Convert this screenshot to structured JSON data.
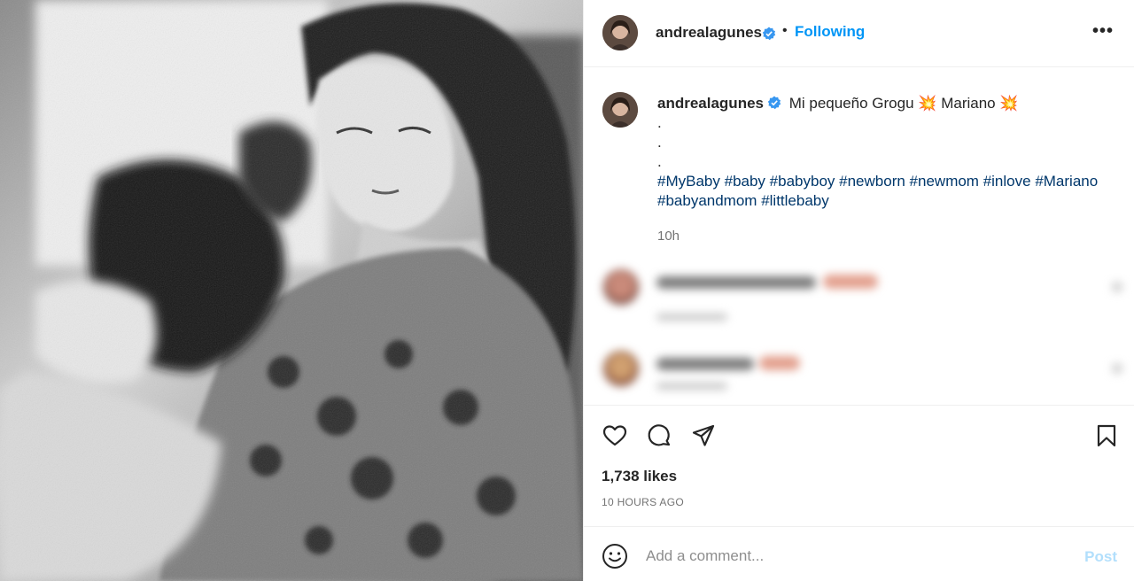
{
  "post": {
    "author": "andrealagunes",
    "follow_separator": "•",
    "follow_label": "Following",
    "more_label": "•••"
  },
  "caption": {
    "author": "andrealagunes",
    "text_before": "Mi pequeño Grogu",
    "emoji_1": "💥",
    "text_middle": "Mariano",
    "emoji_2": "💥",
    "dot_lines": [
      ".",
      ".",
      "."
    ],
    "hashtags": [
      "#MyBaby",
      "#baby",
      "#babyboy",
      "#newborn",
      "#newmom",
      "#inlove",
      "#Mariano",
      "#babyandmom",
      "#littlebaby"
    ],
    "time": "10h"
  },
  "engagement": {
    "likes": "1,738 likes",
    "posted_ago": "10 HOURS AGO"
  },
  "comment_box": {
    "placeholder": "Add a comment...",
    "post_label": "Post"
  },
  "icons": [
    "heart-icon",
    "comment-icon",
    "share-icon",
    "bookmark-icon",
    "emoji-icon",
    "verified-icon",
    "more-icon"
  ],
  "colors": {
    "accent": "#0095f6",
    "hashtag": "#00376b",
    "verified": "#3897f0",
    "post_disabled": "#b2dffc",
    "muted": "#737373"
  }
}
